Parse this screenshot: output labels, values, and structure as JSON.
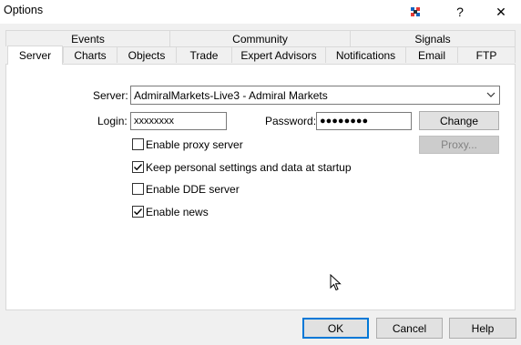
{
  "window": {
    "title": "Options",
    "help_label": "?",
    "close_label": "✕"
  },
  "tabs": {
    "row1": [
      "Events",
      "Community",
      "Signals"
    ],
    "row2": [
      "Server",
      "Charts",
      "Objects",
      "Trade",
      "Expert Advisors",
      "Notifications",
      "Email",
      "FTP"
    ],
    "active": "Server"
  },
  "server": {
    "server_label": "Server:",
    "server_value": "AdmiralMarkets-Live3 - Admiral Markets",
    "login_label": "Login:",
    "login_value": "xxxxxxxx",
    "password_label": "Password:",
    "password_value": "●●●●●●●●",
    "change_label": "Change",
    "proxy_label": "Proxy...",
    "checkboxes": [
      {
        "label": "Enable proxy server",
        "checked": false
      },
      {
        "label": "Keep personal settings and data at startup",
        "checked": true
      },
      {
        "label": "Enable DDE server",
        "checked": false
      },
      {
        "label": "Enable news",
        "checked": true
      }
    ]
  },
  "footer": {
    "ok_label": "OK",
    "cancel_label": "Cancel",
    "help_label": "Help"
  },
  "colors": {
    "accent": "#0078d7",
    "panel": "#ffffff",
    "dialog": "#f0f0f0"
  }
}
